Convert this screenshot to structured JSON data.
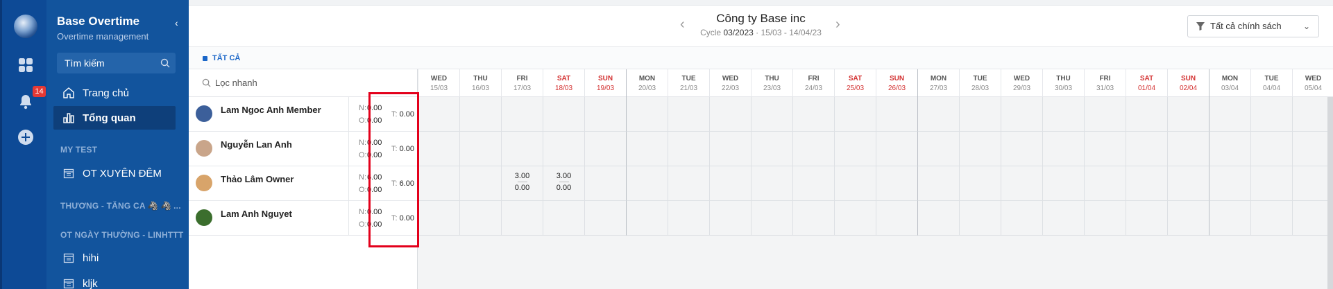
{
  "app": {
    "title": "Base Overtime",
    "subtitle": "Overtime management",
    "notification_count": "14"
  },
  "sidebar": {
    "search_placeholder": "Tìm kiếm",
    "nav": [
      {
        "label": "Trang chủ",
        "icon": "home-icon"
      },
      {
        "label": "Tổng quan",
        "icon": "bar-chart-icon",
        "active": true
      }
    ],
    "sections": [
      {
        "title": "MY TEST",
        "items": [
          {
            "label": "OT XUYÊN ĐÊM",
            "icon": "calendar-icon"
          }
        ]
      },
      {
        "title": "THƯƠNG - TĂNG CA 🦓 🦓 ...",
        "items": []
      },
      {
        "title": "OT NGÀY THƯỜNG - LINHTTT",
        "items": [
          {
            "label": "hihi",
            "icon": "calendar-icon"
          },
          {
            "label": "kljk",
            "icon": "calendar-icon"
          }
        ]
      }
    ]
  },
  "header": {
    "company": "Công ty Base inc",
    "cycle_label": "Cycle",
    "cycle_value": "03/2023",
    "cycle_range": "· 15/03 - 14/04/23",
    "policy_filter": "Tất cả chính sách"
  },
  "tabs": {
    "all_label": "TẤT CẢ"
  },
  "grid": {
    "quick_filter_placeholder": "Lọc nhanh",
    "days": [
      {
        "name": "WED",
        "date": "15/03"
      },
      {
        "name": "THU",
        "date": "16/03"
      },
      {
        "name": "FRI",
        "date": "17/03"
      },
      {
        "name": "SAT",
        "date": "18/03",
        "weekend": true
      },
      {
        "name": "SUN",
        "date": "19/03",
        "weekend": true
      },
      {
        "name": "MON",
        "date": "20/03"
      },
      {
        "name": "TUE",
        "date": "21/03"
      },
      {
        "name": "WED",
        "date": "22/03"
      },
      {
        "name": "THU",
        "date": "23/03"
      },
      {
        "name": "FRI",
        "date": "24/03"
      },
      {
        "name": "SAT",
        "date": "25/03",
        "weekend": true
      },
      {
        "name": "SUN",
        "date": "26/03",
        "weekend": true
      },
      {
        "name": "MON",
        "date": "27/03"
      },
      {
        "name": "TUE",
        "date": "28/03"
      },
      {
        "name": "WED",
        "date": "29/03"
      },
      {
        "name": "THU",
        "date": "30/03"
      },
      {
        "name": "FRI",
        "date": "31/03"
      },
      {
        "name": "SAT",
        "date": "01/04",
        "weekend": true
      },
      {
        "name": "SUN",
        "date": "02/04",
        "weekend": true
      },
      {
        "name": "MON",
        "date": "03/04"
      },
      {
        "name": "TUE",
        "date": "04/04"
      },
      {
        "name": "WED",
        "date": "05/04"
      }
    ],
    "employees": [
      {
        "name": "Lam Ngoc Anh Member",
        "n": "0.00",
        "o": "0.00",
        "t": "0.00",
        "avatar_color": "#3c5f9a",
        "entries": []
      },
      {
        "name": "Nguyễn Lan Anh",
        "n": "0.00",
        "o": "0.00",
        "t": "0.00",
        "avatar_color": "#c9a58a",
        "entries": []
      },
      {
        "name": "Thảo Lâm Owner",
        "n": "6.00",
        "o": "0.00",
        "t": "6.00",
        "avatar_color": "#d8a46a",
        "entries": [
          {
            "day": 2,
            "n": "3.00",
            "o": "0.00"
          },
          {
            "day": 3,
            "n": "3.00",
            "o": "0.00"
          }
        ]
      },
      {
        "name": "Lam Anh Nguyet",
        "n": "0.00",
        "o": "0.00",
        "t": "0.00",
        "avatar_color": "#3b6e2d",
        "entries": []
      }
    ],
    "labels": {
      "n": "N:",
      "o": "O:",
      "t": "T:"
    }
  }
}
